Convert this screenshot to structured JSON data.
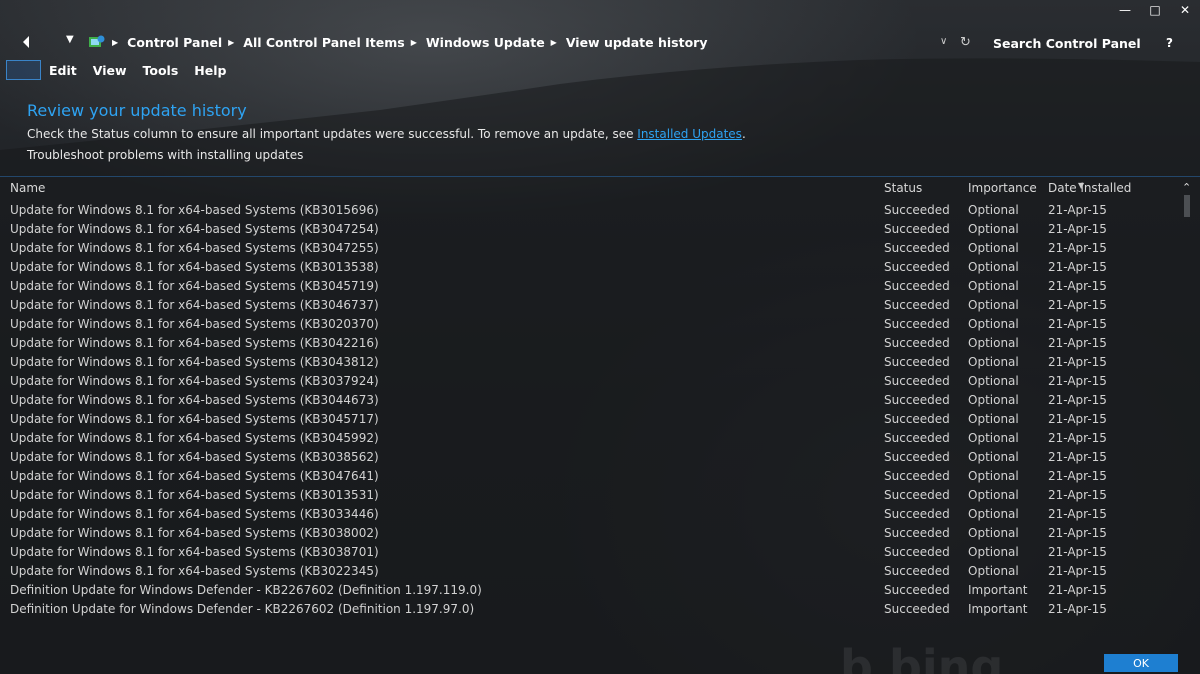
{
  "window": {
    "minimize": "🗕",
    "maximize": "🗖",
    "close": "✕"
  },
  "address_bar": {
    "crumbs": [
      "Control Panel",
      "All Control Panel Items",
      "Windows Update",
      "View update history"
    ],
    "search_placeholder": "Search Control Panel",
    "help": "?"
  },
  "menu": {
    "items": [
      "Edit",
      "View",
      "Tools",
      "Help"
    ]
  },
  "header": {
    "title": "Review your update history",
    "description_prefix": "Check the Status column to ensure all important updates were successful. To remove an update, see ",
    "description_link": "Installed Updates",
    "description_suffix": ".",
    "troubleshoot": "Troubleshoot problems with installing updates"
  },
  "table": {
    "columns": [
      "Name",
      "Status",
      "Importance",
      "Date installed"
    ],
    "rows": [
      [
        "Update for Windows 8.1 for x64-based Systems (KB3015696)",
        "Succeeded",
        "Optional",
        "21-Apr-15"
      ],
      [
        "Update for Windows 8.1 for x64-based Systems (KB3047254)",
        "Succeeded",
        "Optional",
        "21-Apr-15"
      ],
      [
        "Update for Windows 8.1 for x64-based Systems (KB3047255)",
        "Succeeded",
        "Optional",
        "21-Apr-15"
      ],
      [
        "Update for Windows 8.1 for x64-based Systems (KB3013538)",
        "Succeeded",
        "Optional",
        "21-Apr-15"
      ],
      [
        "Update for Windows 8.1 for x64-based Systems (KB3045719)",
        "Succeeded",
        "Optional",
        "21-Apr-15"
      ],
      [
        "Update for Windows 8.1 for x64-based Systems (KB3046737)",
        "Succeeded",
        "Optional",
        "21-Apr-15"
      ],
      [
        "Update for Windows 8.1 for x64-based Systems (KB3020370)",
        "Succeeded",
        "Optional",
        "21-Apr-15"
      ],
      [
        "Update for Windows 8.1 for x64-based Systems (KB3042216)",
        "Succeeded",
        "Optional",
        "21-Apr-15"
      ],
      [
        "Update for Windows 8.1 for x64-based Systems (KB3043812)",
        "Succeeded",
        "Optional",
        "21-Apr-15"
      ],
      [
        "Update for Windows 8.1 for x64-based Systems (KB3037924)",
        "Succeeded",
        "Optional",
        "21-Apr-15"
      ],
      [
        "Update for Windows 8.1 for x64-based Systems (KB3044673)",
        "Succeeded",
        "Optional",
        "21-Apr-15"
      ],
      [
        "Update for Windows 8.1 for x64-based Systems (KB3045717)",
        "Succeeded",
        "Optional",
        "21-Apr-15"
      ],
      [
        "Update for Windows 8.1 for x64-based Systems (KB3045992)",
        "Succeeded",
        "Optional",
        "21-Apr-15"
      ],
      [
        "Update for Windows 8.1 for x64-based Systems (KB3038562)",
        "Succeeded",
        "Optional",
        "21-Apr-15"
      ],
      [
        "Update for Windows 8.1 for x64-based Systems (KB3047641)",
        "Succeeded",
        "Optional",
        "21-Apr-15"
      ],
      [
        "Update for Windows 8.1 for x64-based Systems (KB3013531)",
        "Succeeded",
        "Optional",
        "21-Apr-15"
      ],
      [
        "Update for Windows 8.1 for x64-based Systems (KB3033446)",
        "Succeeded",
        "Optional",
        "21-Apr-15"
      ],
      [
        "Update for Windows 8.1 for x64-based Systems (KB3038002)",
        "Succeeded",
        "Optional",
        "21-Apr-15"
      ],
      [
        "Update for Windows 8.1 for x64-based Systems (KB3038701)",
        "Succeeded",
        "Optional",
        "21-Apr-15"
      ],
      [
        "Update for Windows 8.1 for x64-based Systems (KB3022345)",
        "Succeeded",
        "Optional",
        "21-Apr-15"
      ],
      [
        "Definition Update for Windows Defender - KB2267602 (Definition 1.197.119.0)",
        "Succeeded",
        "Important",
        "21-Apr-15"
      ],
      [
        "Definition Update for Windows Defender - KB2267602 (Definition 1.197.97.0)",
        "Succeeded",
        "Important",
        "21-Apr-15"
      ]
    ]
  },
  "footer": {
    "ok_label": "OK"
  },
  "colors": {
    "accent": "#2ea3f2",
    "ok_button": "#1e7fd1",
    "background": "#1a1d21"
  },
  "icons": {
    "back": "back-arrow-icon",
    "recent": "chevron-down-icon",
    "location": "control-panel-icon",
    "refresh": "refresh-icon",
    "sort": "sort-descending-icon",
    "scroll_up": "scroll-up-icon"
  }
}
